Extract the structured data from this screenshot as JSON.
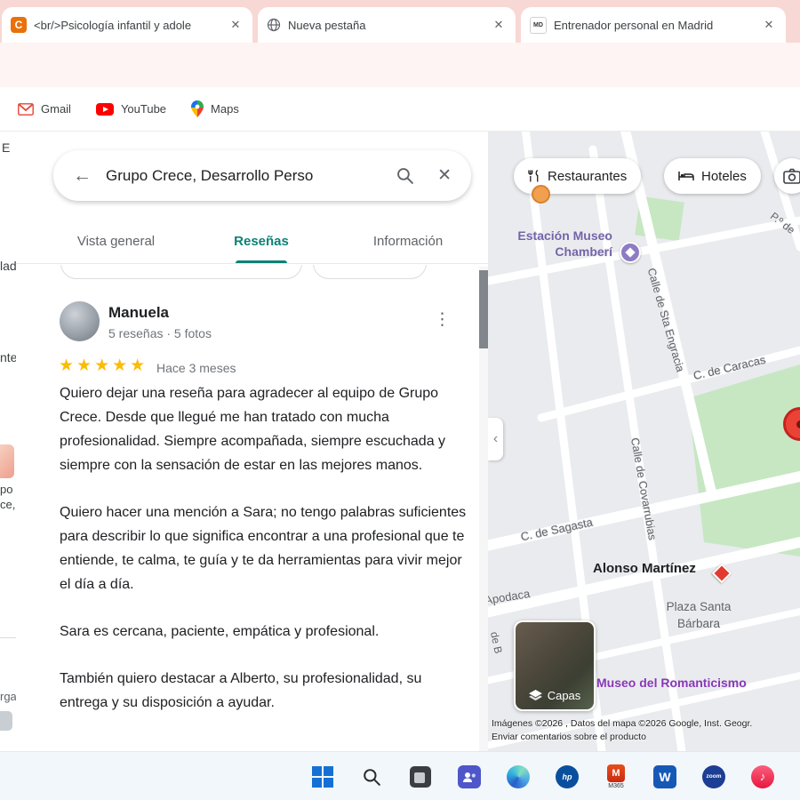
{
  "colors": {
    "accent_teal": "#0c8276",
    "star_gold": "#fbbc04",
    "pin_red": "#ea4335",
    "tab_strip_pink": "#f8d8d4"
  },
  "icons": {
    "forward": "→",
    "back": "←",
    "close": "✕",
    "dots": "⋮",
    "chevron_left": "‹",
    "music_note": "♪"
  },
  "browser": {
    "tabs": [
      {
        "favicon_text": "C",
        "title": "<br/>Psicología infantil y adole"
      },
      {
        "title": "Nueva pestaña"
      },
      {
        "favicon_text": "MD",
        "title": "Entrenador personal en Madrid"
      }
    ],
    "url": "google.com/maps/place/Grupo+Crece,+Desarrollo+Personal+y+Profesional,+S.L./@40.4297071,-3",
    "bookmarks": [
      {
        "label": "Gmail"
      },
      {
        "label": "YouTube"
      },
      {
        "label": "Maps"
      }
    ]
  },
  "fragments": {
    "f1": "E",
    "f2": "lado",
    "f3": "nte",
    "f4": "po",
    "f5": "ce,...",
    "f6": "rgar"
  },
  "panel": {
    "search_value": "Grupo Crece, Desarrollo Perso",
    "tabs": [
      {
        "label": "Vista general"
      },
      {
        "label": "Reseñas"
      },
      {
        "label": "Información"
      }
    ],
    "review": {
      "author": "Manuela",
      "meta": "5 reseñas · 5 fotos",
      "stars": "★★★★★",
      "age": "Hace 3 meses",
      "p1": "Quiero dejar una reseña para agradecer al equipo de Grupo Crece. Desde que llegué me han tratado con mucha profesionalidad. Siempre acompañada, siempre escuchada y siempre con la sensación de estar en las mejores manos.",
      "p2": "Quiero hacer una mención a Sara; no tengo palabras suficientes para describir lo que significa encontrar a una profesional que te entiende, te calma, te guía y te da herramientas para vivir mejor el día a día.",
      "p3": "Sara es cercana, paciente, empática y profesional.",
      "p4": "También quiero destacar a Alberto, su profesionalidad, su entrega y su disposición a ayudar."
    }
  },
  "map": {
    "buttons": {
      "restaurants": "Restaurantes",
      "hotels": "Hoteles"
    },
    "labels": {
      "station1": "Estación Museo",
      "station2": "Chamberí",
      "paseo": "P.º de",
      "caracas": "C. de Caracas",
      "engracia": "Calle de Sta Engracia",
      "covarrubias": "Calle de Covarrubias",
      "sagasta": "C. de Sagasta",
      "alonso": "Alonso Martínez",
      "apodaca": "Apodaca",
      "plaza1": "Plaza Santa",
      "plaza2": "Bárbara",
      "museo": "Museo del Romanticismo",
      "deb": "de B"
    },
    "layers_label": "Capas",
    "attribution1": "Imágenes ©2026 , Datos del mapa ©2026 Google, Inst. Geogr.",
    "attribution2": "Enviar comentarios sobre el producto"
  },
  "taskbar": {
    "hp": "hp",
    "m365": "M365",
    "word": "W",
    "zoom": "zoom"
  }
}
